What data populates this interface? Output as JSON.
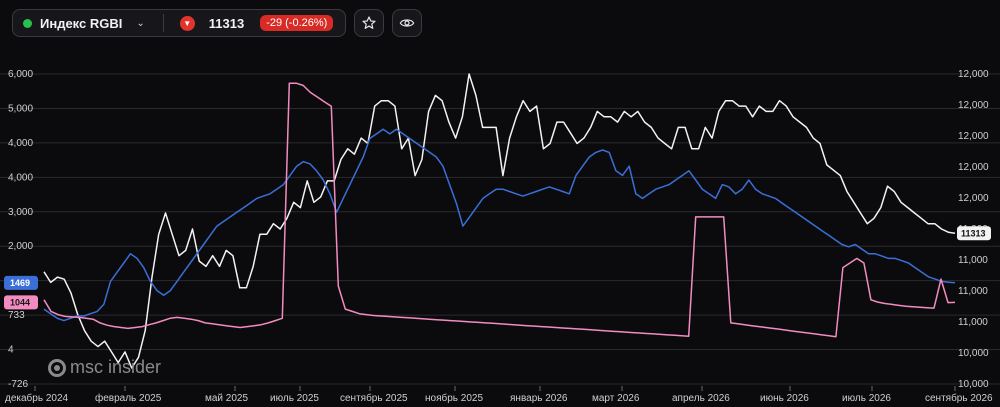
{
  "header": {
    "ticker_name": "Индекс RGBI",
    "price": "11313",
    "change": "-29 (-0.26%)",
    "status_color": "#27c24c",
    "down_color": "#e2342c",
    "icons": [
      "chevron-down-icon",
      "down-arrow-icon",
      "star-icon",
      "eye-icon"
    ]
  },
  "watermark": {
    "text": "msc insider"
  },
  "chart_data": {
    "type": "line",
    "x_ticks": [
      "декабрь 2024",
      "февраль 2025",
      "май 2025",
      "июль 2025",
      "сентябрь 2025",
      "ноябрь 2025",
      "январь 2026",
      "март 2026",
      "апрель 2026",
      "июнь 2026",
      "июль 2026",
      "сентябрь 2026"
    ],
    "left_axis_ticks": [
      "6,000",
      "5,000",
      "4,000",
      "4,000",
      "3,000",
      "2,000",
      "1,000",
      "733",
      "4",
      "-726"
    ],
    "right_axis_ticks": [
      "12,000",
      "12,000",
      "12,000",
      "12,000",
      "12,000",
      "11,000",
      "11,000",
      "11,000",
      "11,000",
      "10,000",
      "10,000"
    ],
    "grid": true,
    "series": [
      {
        "color": "#f2f2f2",
        "axis": "right",
        "last_label": "11313",
        "values": [
          10.95,
          10.85,
          10.9,
          10.88,
          10.75,
          10.55,
          10.4,
          10.3,
          10.25,
          10.3,
          10.2,
          10.1,
          10.2,
          10.05,
          10.15,
          10.4,
          10.9,
          11.3,
          11.5,
          11.3,
          11.1,
          11.15,
          11.35,
          11.05,
          11.0,
          11.1,
          11.0,
          11.15,
          11.1,
          10.8,
          10.8,
          11.0,
          11.3,
          11.3,
          11.4,
          11.35,
          11.45,
          11.6,
          11.55,
          11.8,
          11.6,
          11.65,
          11.8,
          11.8,
          12.0,
          12.1,
          12.05,
          12.2,
          12.15,
          12.5,
          12.55,
          12.55,
          12.5,
          12.1,
          12.2,
          11.85,
          12.0,
          12.45,
          12.6,
          12.55,
          12.35,
          12.2,
          12.4,
          12.8,
          12.6,
          12.3,
          12.3,
          12.3,
          11.85,
          12.2,
          12.4,
          12.55,
          12.45,
          12.5,
          12.1,
          12.15,
          12.35,
          12.35,
          12.25,
          12.15,
          12.2,
          12.3,
          12.45,
          12.4,
          12.4,
          12.35,
          12.45,
          12.4,
          12.45,
          12.35,
          12.3,
          12.2,
          12.15,
          12.1,
          12.3,
          12.3,
          12.1,
          12.1,
          12.3,
          12.2,
          12.45,
          12.55,
          12.55,
          12.5,
          12.5,
          12.4,
          12.5,
          12.45,
          12.45,
          12.55,
          12.5,
          12.4,
          12.35,
          12.3,
          12.2,
          12.15,
          11.95,
          11.9,
          11.85,
          11.7,
          11.6,
          11.5,
          11.4,
          11.45,
          11.55,
          11.75,
          11.7,
          11.6,
          11.55,
          11.5,
          11.45,
          11.4,
          11.4,
          11.35,
          11.32,
          11.31
        ]
      },
      {
        "color": "#3a6fd8",
        "axis": "left",
        "last_label": "1469",
        "values": [
          900,
          800,
          700,
          650,
          700,
          750,
          750,
          800,
          850,
          1000,
          1500,
          1700,
          1900,
          2100,
          2000,
          1800,
          1500,
          1300,
          1200,
          1300,
          1500,
          1700,
          1900,
          2100,
          2300,
          2500,
          2700,
          2800,
          2900,
          3000,
          3100,
          3200,
          3300,
          3350,
          3400,
          3500,
          3600,
          3800,
          4000,
          4100,
          4050,
          3900,
          3700,
          3400,
          3000,
          3300,
          3600,
          3900,
          4200,
          4600,
          4700,
          4800,
          4700,
          4800,
          4700,
          4600,
          4500,
          4400,
          4300,
          4200,
          4000,
          3600,
          3200,
          2700,
          2900,
          3100,
          3300,
          3400,
          3500,
          3500,
          3450,
          3400,
          3350,
          3400,
          3450,
          3500,
          3550,
          3500,
          3450,
          3400,
          3800,
          4000,
          4200,
          4300,
          4350,
          4300,
          3900,
          3800,
          4000,
          3400,
          3300,
          3400,
          3500,
          3550,
          3600,
          3700,
          3800,
          3900,
          3700,
          3500,
          3400,
          3300,
          3600,
          3550,
          3400,
          3500,
          3700,
          3500,
          3400,
          3350,
          3300,
          3200,
          3100,
          3000,
          2900,
          2800,
          2700,
          2600,
          2500,
          2400,
          2300,
          2250,
          2300,
          2200,
          2100,
          2100,
          2050,
          2000,
          2000,
          1950,
          1900,
          1800,
          1700,
          1600,
          1550,
          1500,
          1480,
          1469
        ]
      },
      {
        "color": "#f28cc0",
        "axis": "left",
        "last_label": "1044",
        "values": [
          1100,
          850,
          780,
          740,
          730,
          720,
          700,
          680,
          600,
          550,
          520,
          500,
          480,
          500,
          520,
          560,
          600,
          650,
          700,
          720,
          700,
          680,
          650,
          600,
          580,
          560,
          540,
          520,
          500,
          520,
          540,
          560,
          600,
          650,
          700,
          5800,
          5800,
          5750,
          5600,
          5500,
          5400,
          5300,
          1400,
          900,
          850,
          800,
          780,
          760,
          750,
          740,
          730,
          720,
          710,
          700,
          690,
          680,
          670,
          660,
          650,
          640,
          630,
          620,
          610,
          600,
          590,
          580,
          570,
          560,
          550,
          540,
          530,
          520,
          510,
          500,
          490,
          480,
          470,
          460,
          450,
          440,
          430,
          420,
          410,
          400,
          390,
          380,
          370,
          360,
          350,
          340,
          330,
          320,
          310,
          2900,
          2900,
          2900,
          2900,
          2900,
          600,
          580,
          560,
          540,
          520,
          500,
          480,
          460,
          440,
          420,
          400,
          380,
          360,
          340,
          320,
          300,
          1800,
          1900,
          2000,
          1900,
          1100,
          1050,
          1020,
          1000,
          980,
          960,
          950,
          940,
          930,
          920,
          1550,
          1040,
          1044
        ]
      }
    ]
  }
}
